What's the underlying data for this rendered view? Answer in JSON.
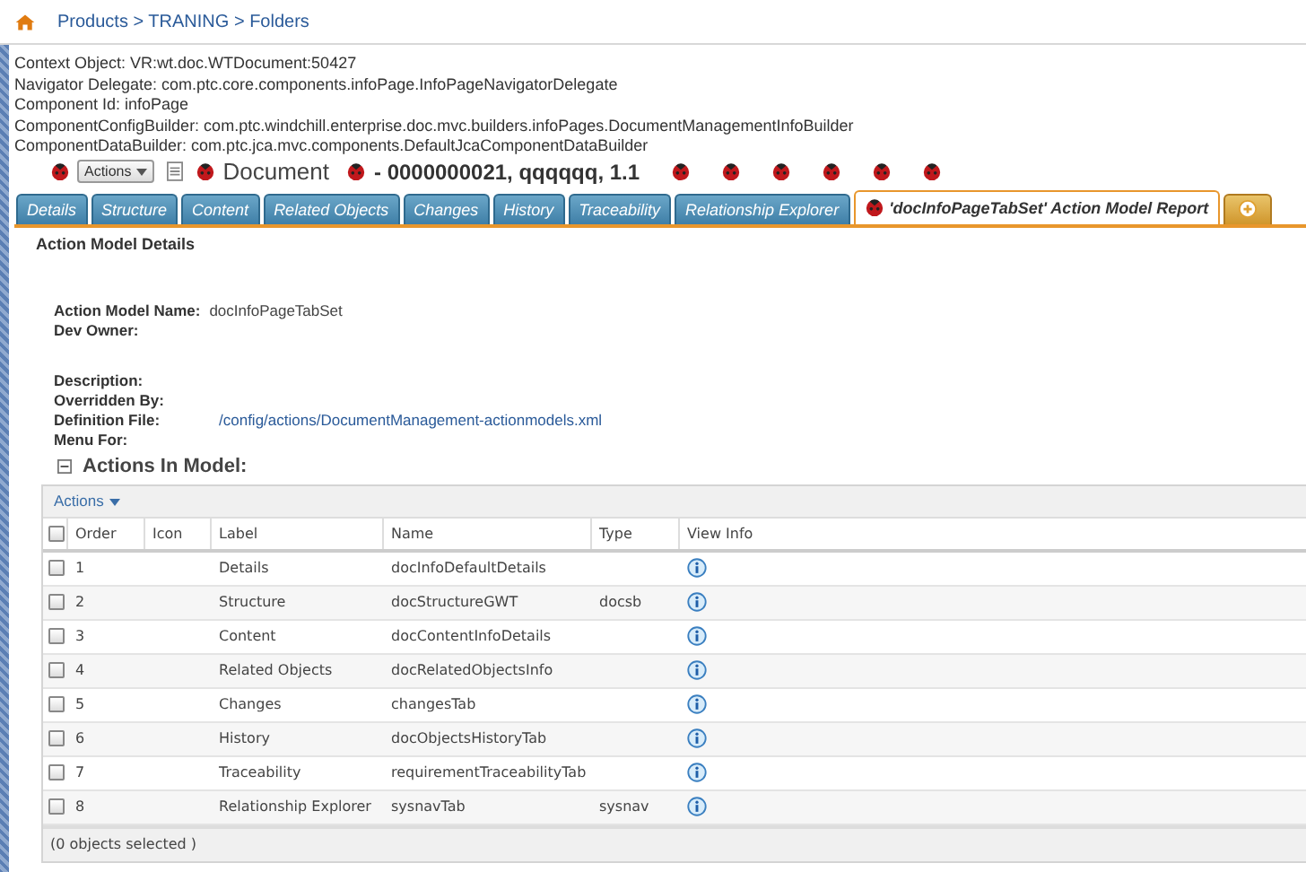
{
  "breadcrumb": "Products > TRANING > Folders",
  "info_lines": [
    "Context Object: VR:wt.doc.WTDocument:50427",
    "Navigator Delegate: com.ptc.core.components.infoPage.InfoPageNavigatorDelegate",
    "Component Id: infoPage",
    "ComponentConfigBuilder: com.ptc.windchill.enterprise.doc.mvc.builders.infoPages.DocumentManagementInfoBuilder",
    "ComponentDataBuilder: com.ptc.jca.mvc.components.DefaultJcaComponentDataBuilder"
  ],
  "toolbar": {
    "actions_button": "Actions",
    "type_label": "Document",
    "object_title": "- 0000000021, qqqqqq, 1.1"
  },
  "tabs": [
    {
      "label": "Details",
      "selected": false
    },
    {
      "label": "Structure",
      "selected": false
    },
    {
      "label": "Content",
      "selected": false
    },
    {
      "label": "Related Objects",
      "selected": false
    },
    {
      "label": "Changes",
      "selected": false
    },
    {
      "label": "History",
      "selected": false
    },
    {
      "label": "Traceability",
      "selected": false
    },
    {
      "label": "Relationship Explorer",
      "selected": false
    },
    {
      "label": "'docInfoPageTabSet' Action Model Report",
      "selected": true
    }
  ],
  "section_title": "Action Model Details",
  "properties": [
    {
      "label": "Action Model Name:",
      "value": "docInfoPageTabSet",
      "kind": "text"
    },
    {
      "label": "Dev Owner:",
      "kind": "text"
    },
    {
      "kind": "gap"
    },
    {
      "label": "Description:",
      "kind": "text"
    },
    {
      "label": "Overridden By:",
      "kind": "text"
    },
    {
      "label": "Definition File:",
      "value": "/config/actions/DocumentManagement-actionmodels.xml",
      "kind": "link"
    },
    {
      "label": "Menu For:",
      "kind": "text"
    }
  ],
  "table": {
    "title": "Actions In Model:",
    "expanded": true,
    "actions_menu": "Actions",
    "all_checked": false,
    "columns": [
      "Order",
      "Icon",
      "Label",
      "Name",
      "Type",
      "View Info"
    ],
    "rows": [
      {
        "order": "1",
        "label": "Details",
        "name": "docInfoDefaultDetails",
        "checked": false
      },
      {
        "order": "2",
        "label": "Structure",
        "name": "docStructureGWT",
        "type": "docsb",
        "checked": false
      },
      {
        "order": "3",
        "label": "Content",
        "name": "docContentInfoDetails",
        "checked": false
      },
      {
        "order": "4",
        "label": "Related Objects",
        "name": "docRelatedObjectsInfo",
        "checked": false
      },
      {
        "order": "5",
        "label": "Changes",
        "name": "changesTab",
        "checked": false
      },
      {
        "order": "6",
        "label": "History",
        "name": "docObjectsHistoryTab",
        "checked": false
      },
      {
        "order": "7",
        "label": "Traceability",
        "name": "requirementTraceabilityTab",
        "checked": false
      },
      {
        "order": "8",
        "label": "Relationship Explorer",
        "name": "sysnavTab",
        "type": "sysnav",
        "checked": false
      }
    ],
    "footer": "(0 objects selected )"
  }
}
